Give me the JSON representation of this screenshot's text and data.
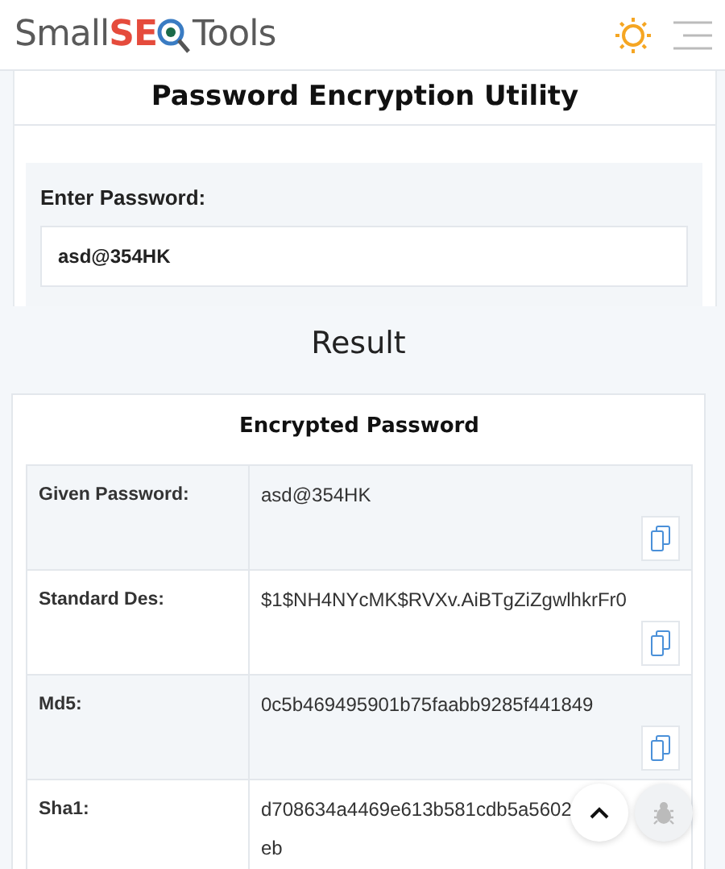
{
  "header": {
    "logo": [
      "Small",
      "SE",
      "Tools"
    ]
  },
  "tool": {
    "title": "Password Encryption Utility",
    "label": "Enter Password:",
    "value": "asd@354HK"
  },
  "result": {
    "title": "Result",
    "card_title": "Encrypted Password",
    "rows": [
      {
        "label": "Given Password:",
        "value": [
          "asd@354HK"
        ],
        "copy": true
      },
      {
        "label": "Standard Des:",
        "value": [
          "$1$NH4NYcMK$RVXv.AiBTgZiZgwlhkrFr0"
        ],
        "copy": true
      },
      {
        "label": "Md5:",
        "value": [
          "0c5b469495901b75faabb9285f441849"
        ],
        "copy": true
      },
      {
        "label": "Sha1:",
        "value": [
          "d708634a4469e613b581cdb5a5602",
          "eb"
        ],
        "copy": false
      }
    ]
  }
}
